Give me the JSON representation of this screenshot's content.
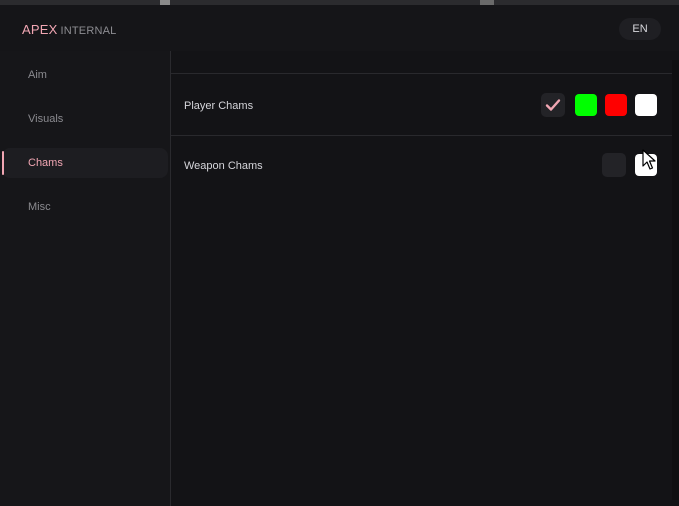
{
  "header": {
    "brand_accent": "APEX",
    "brand_rest": "INTERNAL",
    "language": "EN"
  },
  "sidebar": {
    "items": [
      {
        "label": "Aim",
        "active": false
      },
      {
        "label": "Visuals",
        "active": false
      },
      {
        "label": "Chams",
        "active": true
      },
      {
        "label": "Misc",
        "active": false
      }
    ]
  },
  "main": {
    "options": [
      {
        "label": "Player Chams",
        "enabled": true,
        "colors": [
          "#00ff00",
          "#ff0000",
          "#ffffff"
        ]
      },
      {
        "label": "Weapon Chams",
        "enabled": false,
        "colors": [
          "#ffffff"
        ]
      }
    ]
  },
  "theme": {
    "accent": "#f1a6b3",
    "background": "#131316",
    "sidebar": "#161619"
  }
}
